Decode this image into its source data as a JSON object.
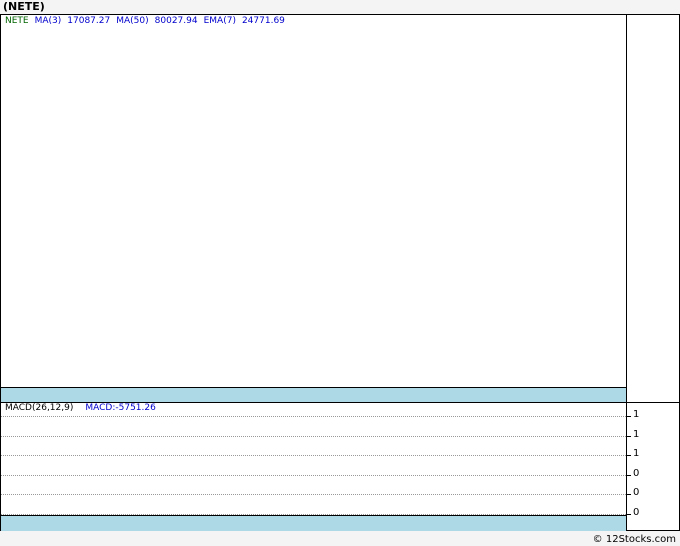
{
  "title": "(NETE)",
  "price_legend": {
    "symbol": "NETE",
    "ma3_label": "MA(3)",
    "ma3_value": "17087.27",
    "ma50_label": "MA(50)",
    "ma50_value": "80027.94",
    "ema7_label": "EMA(7)",
    "ema7_value": "24771.69"
  },
  "macd_legend": {
    "label": "MACD(26,12,9)",
    "value": "MACD:-5751.26"
  },
  "footer": "© 12Stocks.com",
  "colors": {
    "symbol": "#006400",
    "indicator": "#0000cd",
    "band": "#add8e6"
  },
  "chart_data": [
    {
      "type": "line",
      "title": "(NETE)",
      "series": [],
      "grid": false
    },
    {
      "type": "line",
      "title": "MACD(26,12,9)",
      "series": [],
      "yticks": [
        "1",
        "1",
        "1",
        "0",
        "0",
        "0"
      ],
      "grid": true
    }
  ]
}
